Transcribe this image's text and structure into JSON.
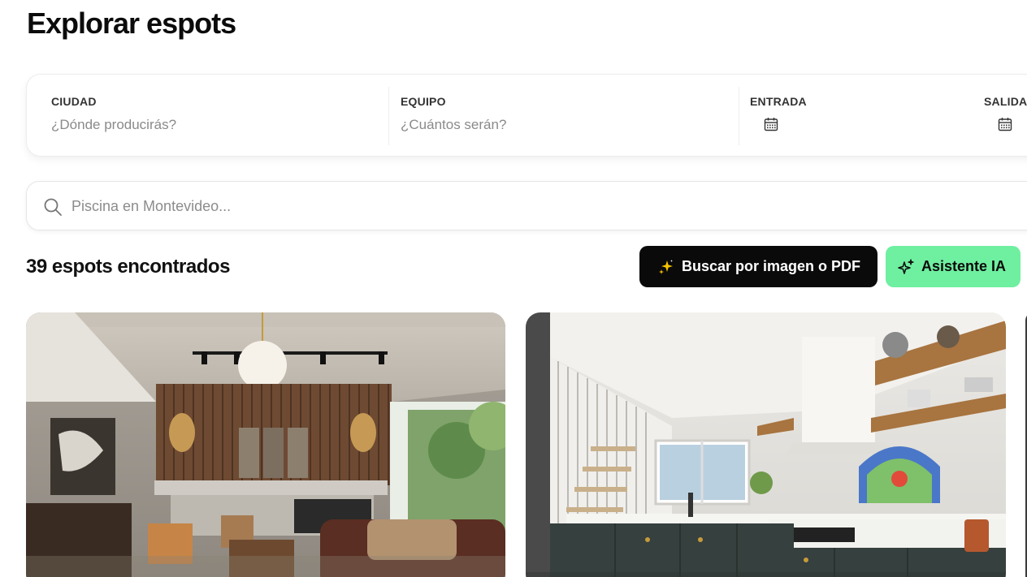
{
  "page": {
    "title": "Explorar espots"
  },
  "filters": {
    "city": {
      "label": "CIUDAD",
      "placeholder": "¿Dónde producirás?"
    },
    "team": {
      "label": "EQUIPO",
      "placeholder": "¿Cuántos serán?"
    },
    "checkin": {
      "label": "ENTRADA",
      "icon": "calendar-icon"
    },
    "checkout": {
      "label": "SALIDA",
      "icon": "calendar-icon"
    }
  },
  "search": {
    "placeholder": "Piscina en Montevideo...",
    "icon": "search-icon"
  },
  "results": {
    "count_text": "39 espots encontrados"
  },
  "actions": {
    "image_search": {
      "label": "Buscar por imagen o PDF",
      "icon": "sparkles-icon"
    },
    "assistant": {
      "label": "Asistente IA",
      "icon": "sparkles-icon"
    }
  },
  "listings": [
    {
      "name": "living-room-photo"
    },
    {
      "name": "kitchen-photo"
    }
  ],
  "colors": {
    "accent_green": "#6fefa0",
    "dark_button": "#0a0a0a"
  }
}
